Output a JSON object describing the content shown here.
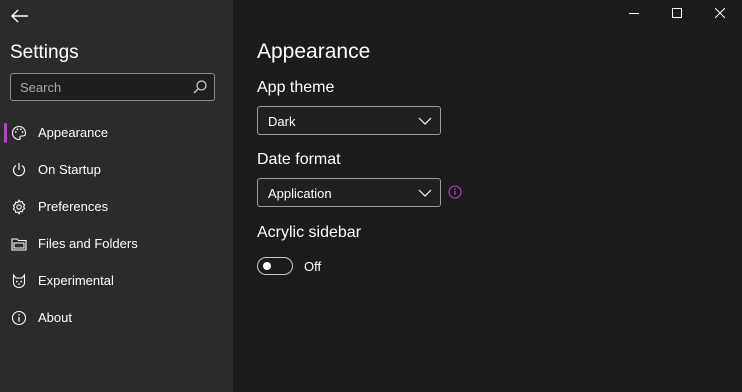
{
  "sidebar": {
    "title": "Settings",
    "search_placeholder": "Search",
    "items": [
      {
        "label": "Appearance",
        "icon": "palette-icon",
        "selected": true
      },
      {
        "label": "On Startup",
        "icon": "power-icon"
      },
      {
        "label": "Preferences",
        "icon": "gear-icon"
      },
      {
        "label": "Files and Folders",
        "icon": "folder-icon"
      },
      {
        "label": "Experimental",
        "icon": "cat-icon"
      },
      {
        "label": "About",
        "icon": "info-icon"
      }
    ]
  },
  "main": {
    "title": "Appearance",
    "app_theme": {
      "label": "App theme",
      "value": "Dark"
    },
    "date_format": {
      "label": "Date format",
      "value": "Application"
    },
    "acrylic_sidebar": {
      "label": "Acrylic sidebar",
      "state": "Off"
    }
  },
  "colors": {
    "accent": "#b146c2",
    "sidebar_bg": "#2b2b2b",
    "content_bg": "#1c1c1c"
  }
}
